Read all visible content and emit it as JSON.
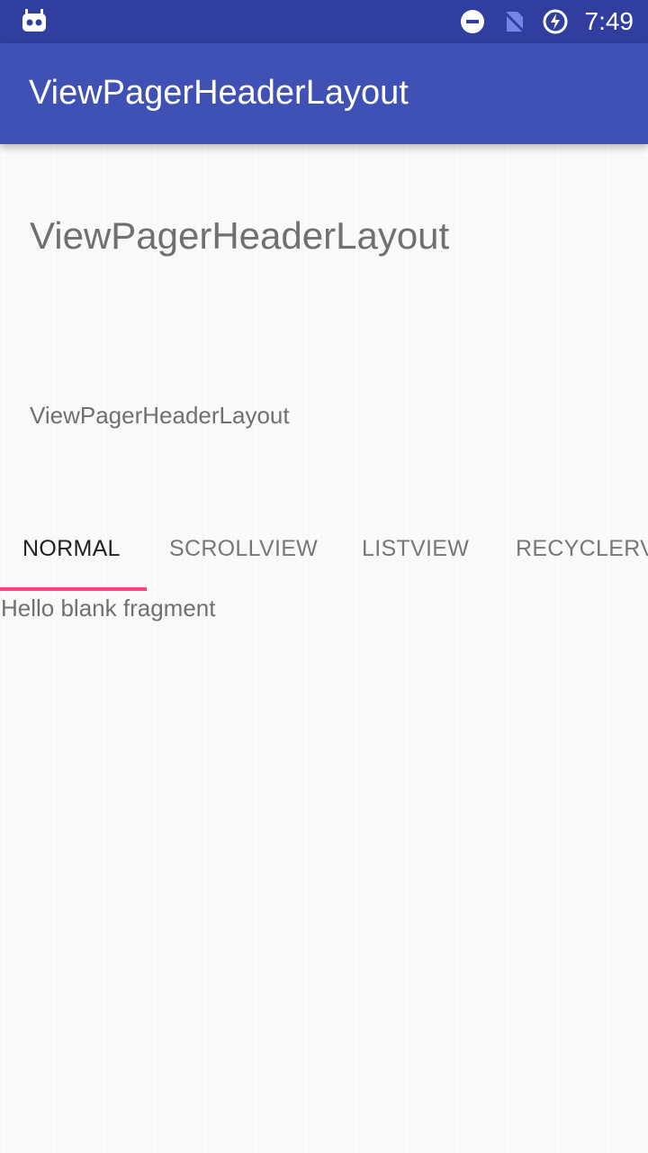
{
  "status_bar": {
    "time": "7:49",
    "icons": [
      "android-debug-icon",
      "do-not-disturb-icon",
      "no-sim-icon",
      "battery-charging-icon"
    ]
  },
  "app_bar": {
    "title": "ViewPagerHeaderLayout"
  },
  "header": {
    "title": "ViewPagerHeaderLayout",
    "subtitle": "ViewPagerHeaderLayout"
  },
  "tabs": [
    {
      "label": "NORMAL",
      "selected": true
    },
    {
      "label": "SCROLLVIEW",
      "selected": false
    },
    {
      "label": "LISTVIEW",
      "selected": false
    },
    {
      "label": "RECYCLERVIEW",
      "selected": false
    }
  ],
  "fragment": {
    "text": "Hello blank fragment"
  },
  "colors": {
    "status_bar": "#303f9f",
    "app_bar": "#3f51b5",
    "tab_indicator": "#ff4081",
    "background": "#fafafa"
  }
}
